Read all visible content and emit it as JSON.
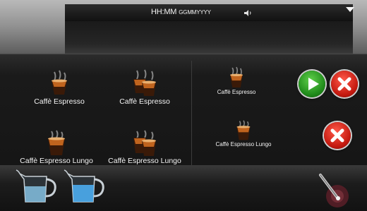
{
  "status_bar": {
    "time_text": "HH:MM",
    "date_text": "GGMMYYYY",
    "icons": [
      "speaker-icon",
      "menu-arrow-icon"
    ]
  },
  "left_panel": {
    "drinks": [
      {
        "label": "Caffè Espresso",
        "icon": "espresso-cup-icon"
      },
      {
        "label": "Caffè Espresso",
        "icon": "double-espresso-cup-icon"
      },
      {
        "label": "Caffè Espresso Lungo",
        "icon": "lungo-cup-icon"
      },
      {
        "label": "Caffè Espresso Lungo",
        "icon": "double-lungo-cup-icon"
      }
    ]
  },
  "right_panel": {
    "queue": [
      {
        "label": "Caffè Espresso",
        "icon": "espresso-cup-icon",
        "actions": [
          "start-icon",
          "cancel-icon"
        ]
      },
      {
        "label": "Caffè Espresso Lungo",
        "icon": "lungo-cup-icon",
        "actions": [
          "cancel-icon"
        ]
      }
    ]
  },
  "bottom_bar": {
    "icons": [
      "milk-jug-icon",
      "hot-water-jug-icon",
      "steam-wand-icon"
    ]
  },
  "colors": {
    "play": "#1f8a1a",
    "cancel": "#c4190f",
    "text": "#f4f4f4"
  }
}
